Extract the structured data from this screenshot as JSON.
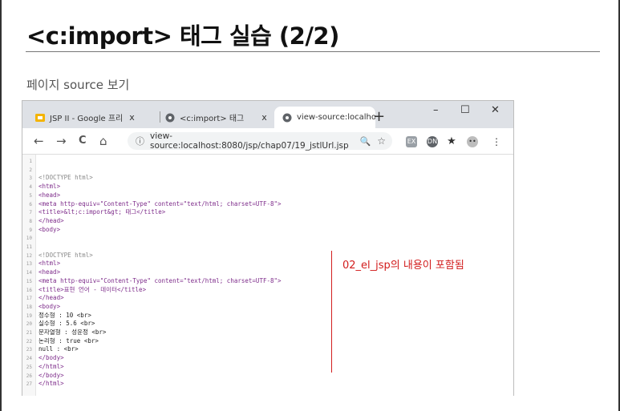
{
  "slide": {
    "title": "<c:import> 태그 실습 (2/2)",
    "subtitle": "페이지 source 보기"
  },
  "browser": {
    "tabs": [
      {
        "label": "JSP II - Google 프리",
        "close": "x",
        "icon": "slides-icon"
      },
      {
        "label": "<c:import> 태그",
        "close": "x",
        "icon": "globe-icon"
      },
      {
        "label": "view-source:localho",
        "close": "x",
        "icon": "globe-icon"
      }
    ],
    "new_tab": "+",
    "window_controls": {
      "minimize": "–",
      "maximize": "☐",
      "close": "✕"
    },
    "nav": {
      "back": "←",
      "forward": "→",
      "reload": "C",
      "home": "⌂"
    },
    "url": "view-source:localhost:8080/jsp/chap07/19_jstlUrl.jsp",
    "info_icon": "ⓘ",
    "zoom_icon": "🔍",
    "star_icon": "☆",
    "ext_labels": [
      "EX",
      "DN",
      "★",
      "••",
      "⋮"
    ]
  },
  "source_lines": [
    {
      "n": "1",
      "t": ""
    },
    {
      "n": "2",
      "t": ""
    },
    {
      "n": "3",
      "t": "<!DOCTYPE html>"
    },
    {
      "n": "4",
      "t": "<html>"
    },
    {
      "n": "5",
      "t": "<head>"
    },
    {
      "n": "6",
      "t": "<meta http-equiv=\"Content-Type\" content=\"text/html; charset=UTF-8\">"
    },
    {
      "n": "7",
      "t": "<title>&lt;c:import&gt; 태그</title>"
    },
    {
      "n": "8",
      "t": "</head>"
    },
    {
      "n": "9",
      "t": "<body>"
    },
    {
      "n": "10",
      "t": ""
    },
    {
      "n": "11",
      "t": ""
    },
    {
      "n": "12",
      "t": "<!DOCTYPE html>"
    },
    {
      "n": "13",
      "t": "<html>"
    },
    {
      "n": "14",
      "t": "<head>"
    },
    {
      "n": "15",
      "t": "<meta http-equiv=\"Content-Type\" content=\"text/html; charset=UTF-8\">"
    },
    {
      "n": "16",
      "t": "<title>표현 언어 - 데이터</title>"
    },
    {
      "n": "17",
      "t": "</head>"
    },
    {
      "n": "18",
      "t": "<body>"
    },
    {
      "n": "19",
      "t": "정수형 : 10 <br>"
    },
    {
      "n": "20",
      "t": "실수형 : 5.6 <br>"
    },
    {
      "n": "21",
      "t": "문자열형 : 성윤정 <br>"
    },
    {
      "n": "22",
      "t": "논리형 : true <br>"
    },
    {
      "n": "23",
      "t": "null : <br>"
    },
    {
      "n": "24",
      "t": "</body>"
    },
    {
      "n": "25",
      "t": "</html>"
    },
    {
      "n": "26",
      "t": "</body>"
    },
    {
      "n": "27",
      "t": "</html>"
    }
  ],
  "annotation": "02_el_jsp의 내용이 포함됨",
  "colors": {
    "annotation": "#d21d1d",
    "tabstrip": "#dee1e6",
    "tag": "#7d2b8a"
  }
}
